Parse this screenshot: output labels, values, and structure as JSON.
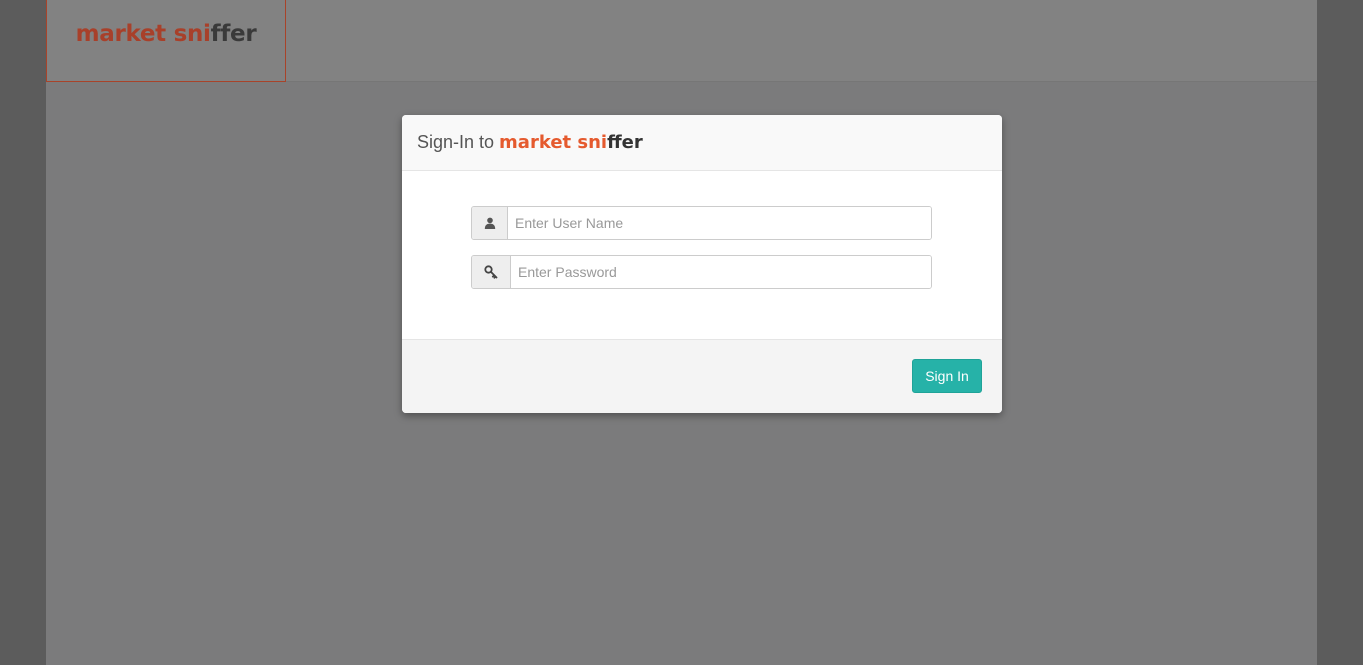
{
  "header": {
    "brand_part1": "market sni",
    "brand_part2": "ffer"
  },
  "signin_modal": {
    "title_prefix": "Sign-In to ",
    "brand_part1": "market sni",
    "brand_part2": "ffer",
    "username": {
      "icon": "user-icon",
      "value": "",
      "placeholder": "Enter User Name"
    },
    "password": {
      "icon": "key-icon",
      "value": "",
      "placeholder": "Enter Password"
    },
    "submit_label": "Sign In"
  },
  "colors": {
    "brand_primary": "#e55a2e",
    "brand_dark": "#333333",
    "button": "#26b2a8",
    "overlay": "#7b7b7c"
  }
}
